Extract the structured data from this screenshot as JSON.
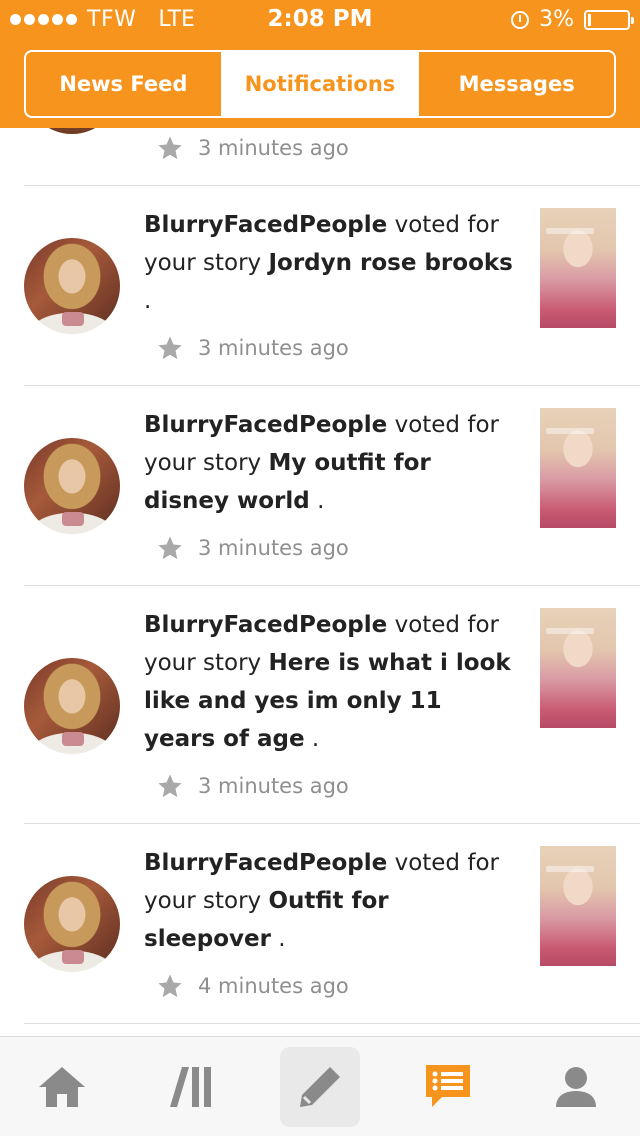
{
  "status_bar": {
    "carrier": "TFW",
    "network": "LTE",
    "time": "2:08 PM",
    "battery": "3%"
  },
  "tabs": [
    {
      "label": "News Feed",
      "active": false
    },
    {
      "label": "Notifications",
      "active": true
    },
    {
      "label": "Messages",
      "active": false
    }
  ],
  "partial_item": {
    "time": "3 minutes ago"
  },
  "notifications": [
    {
      "user": "BlurryFacedPeople",
      "action": "voted for",
      "prefix": "your story",
      "story": "Jordyn rose brooks",
      "suffix": ".",
      "time": "3 minutes ago"
    },
    {
      "user": "BlurryFacedPeople",
      "action": "voted for",
      "prefix": "your story",
      "story": "My outfit for disney world",
      "suffix": ".",
      "time": "3 minutes ago"
    },
    {
      "user": "BlurryFacedPeople",
      "action": "voted for",
      "prefix": "your story",
      "story": "Here is what i look like and yes im only 11 years of age",
      "suffix": ".",
      "time": "3 minutes ago"
    },
    {
      "user": "BlurryFacedPeople",
      "action": "voted for",
      "prefix": "your story",
      "story": "Outfit for sleepover",
      "suffix": ".",
      "time": "4 minutes ago"
    }
  ],
  "bottom_nav": [
    {
      "icon": "home-icon",
      "active": false
    },
    {
      "icon": "library-icon",
      "active": false
    },
    {
      "icon": "pencil-icon",
      "active": false,
      "highlighted": true
    },
    {
      "icon": "notifications-icon",
      "active": true
    },
    {
      "icon": "profile-icon",
      "active": false
    }
  ],
  "colors": {
    "accent": "#f7941d",
    "meta_text": "#8f8f8f",
    "divider": "#dddddd"
  }
}
